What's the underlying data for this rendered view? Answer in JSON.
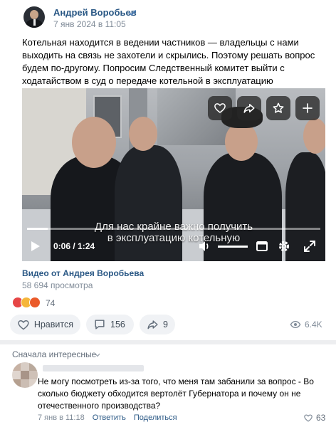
{
  "post": {
    "author": "Андрей Воробьев",
    "date": "7 янв 2024 в 11:05",
    "text": "Котельная находится в ведении частников — владельцы с нами выходить на связь не захотели и скрылись. Поэтому решать вопрос будем по-другому. Попросим Следственный комитет выйти с ходатайством в суд о передаче котельной в эксплуатацию муниципального предприятию."
  },
  "video": {
    "caption_line1": "Для нас крайне важно получить",
    "caption_line2": "в эксплуатацию котельную",
    "current_time": "0:06 / 1:24",
    "progress": 0.07,
    "volume": 1.0,
    "title": "Видео от Андрея Воробьева",
    "views": "58 694 просмотра",
    "overlay_icons": [
      "heart-icon",
      "share-icon",
      "star-icon",
      "plus-icon"
    ]
  },
  "reactions": {
    "count": "74",
    "emojis": [
      "heart",
      "surprised",
      "angry"
    ]
  },
  "actions": {
    "like_label": "Нравится",
    "comments_count": "156",
    "shares_count": "9",
    "views": "6.4K"
  },
  "comments": {
    "sort_label": "Сначала интересные",
    "items": [
      {
        "text": "Не могу посмотреть из-за того, что меня там забанили за вопрос - Во сколько бюджету обходится вертолёт Губернатора и почему он не отечественного производства?",
        "time": "7 янв в 11:18",
        "reply_label": "Ответить",
        "share_label": "Поделиться",
        "likes": "63"
      }
    ]
  },
  "colors": {
    "link": "#2a5885",
    "secondary": "#818c99",
    "button_bg": "#f0f2f5",
    "verified": "#5181b8"
  }
}
